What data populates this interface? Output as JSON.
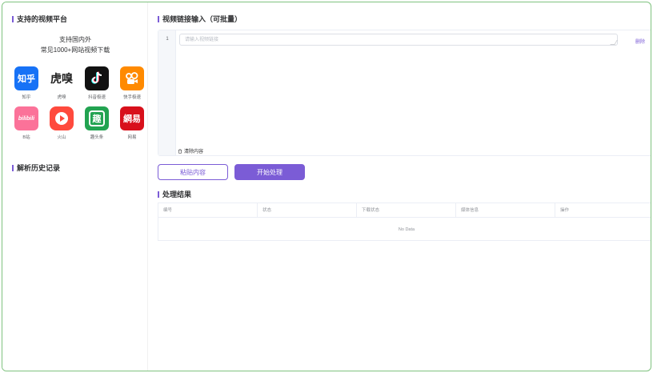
{
  "sidebar": {
    "platforms_title": "支持的视频平台",
    "intro_line1": "支持国内外",
    "intro_line2": "常见1000+网站视频下载",
    "platforms": [
      {
        "name": "知乎",
        "logo_text": "知乎",
        "icon": "zhihu-icon",
        "color": "#1772f6"
      },
      {
        "name": "虎嗅",
        "logo_text": "虎嗅",
        "icon": "huxiu-icon",
        "color": "#ffffff"
      },
      {
        "name": "抖音极速",
        "logo_text": "♪",
        "icon": "douyin-icon",
        "color": "#111111"
      },
      {
        "name": "快手极速",
        "logo_text": "▶",
        "icon": "kuaishou-icon",
        "color": "#ff8a00"
      },
      {
        "name": "B站",
        "logo_text": "bilibili",
        "icon": "bilibili-icon",
        "color": "#fb7299"
      },
      {
        "name": "火山",
        "logo_text": "▶",
        "icon": "huoshan-icon",
        "color": "#ff4a3d"
      },
      {
        "name": "趣头条",
        "logo_text": "趣",
        "icon": "qutoutiao-icon",
        "color": "#22a351"
      },
      {
        "name": "网易",
        "logo_text": "網易",
        "icon": "netease-icon",
        "color": "#d8101b"
      }
    ],
    "history_title": "解析历史记录"
  },
  "main": {
    "input_title": "视频链接输入（可批量）",
    "line_number": "1",
    "link_placeholder": "请输入视频链接",
    "delete_label": "删除",
    "clear_label": "清除内容",
    "paste_button": "粘贴内容",
    "start_button": "开始处理",
    "results_title": "处理结果",
    "table": {
      "columns": [
        "编号",
        "状态",
        "下载状态",
        "媒体信息",
        "操作"
      ],
      "empty_text": "No Data"
    }
  },
  "colors": {
    "accent": "#7b5cd6",
    "frame_border": "#7fc27f"
  }
}
